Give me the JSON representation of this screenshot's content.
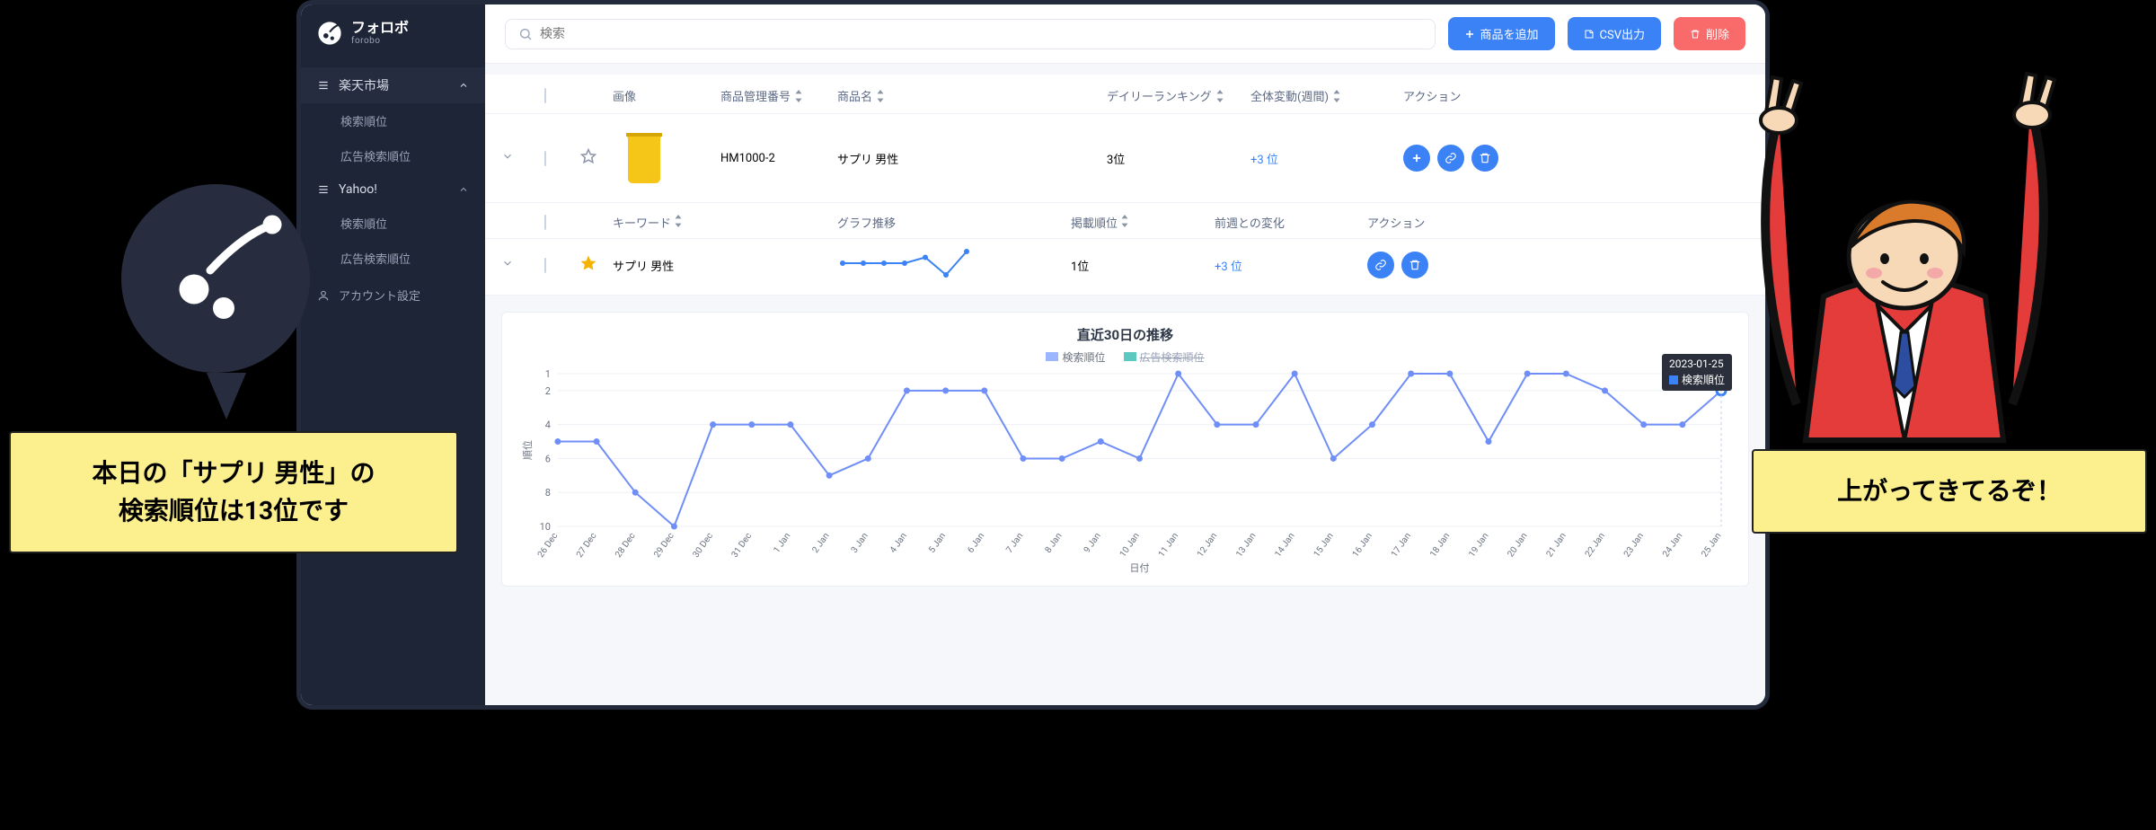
{
  "brand": {
    "ja": "フォロボ",
    "en": "forobo"
  },
  "sidebar": {
    "groups": [
      {
        "label": "楽天市場",
        "items": [
          "検索順位",
          "広告検索順位"
        ]
      },
      {
        "label": "Yahoo!",
        "items": [
          "検索順位",
          "広告検索順位"
        ]
      }
    ],
    "account": "アカウント設定"
  },
  "topbar": {
    "search_placeholder": "検索",
    "add_label": "商品を追加",
    "csv_label": "CSV出力",
    "delete_label": "削除"
  },
  "table": {
    "headers": {
      "image": "画像",
      "sku": "商品管理番号",
      "name": "商品名",
      "daily": "デイリーランキング",
      "weekly": "全体変動(週間)",
      "action": "アクション"
    },
    "row": {
      "sku": "HM1000-2",
      "name": "サプリ 男性",
      "daily": "3位",
      "weekly": "+3 位"
    }
  },
  "subtable": {
    "headers": {
      "keyword": "キーワード",
      "graph": "グラフ推移",
      "rank": "掲載順位",
      "weekchg": "前週との変化",
      "action": "アクション"
    },
    "row": {
      "keyword": "サプリ 男性",
      "rank": "1位",
      "weekchg": "+3 位"
    }
  },
  "callouts": {
    "left_l1": "本日の「サプリ 男性」の",
    "left_l2": "検索順位は13位です",
    "right": "上がってきてるぞ！"
  },
  "chart_data": {
    "type": "line",
    "title": "直近30日の推移",
    "xlabel": "日付",
    "ylabel": "順位",
    "ylim": [
      1,
      10
    ],
    "y_ticks": [
      1,
      2,
      4,
      6,
      8,
      10
    ],
    "legend": [
      "検索順位",
      "広告検索順位"
    ],
    "categories": [
      "26 Dec",
      "27 Dec",
      "28 Dec",
      "29 Dec",
      "30 Dec",
      "31 Dec",
      "1 Jan",
      "2 Jan",
      "3 Jan",
      "4 Jan",
      "5 Jan",
      "6 Jan",
      "7 Jan",
      "8 Jan",
      "9 Jan",
      "10 Jan",
      "11 Jan",
      "12 Jan",
      "13 Jan",
      "14 Jan",
      "15 Jan",
      "16 Jan",
      "17 Jan",
      "18 Jan",
      "19 Jan",
      "20 Jan",
      "21 Jan",
      "22 Jan",
      "23 Jan",
      "24 Jan",
      "25 Jan"
    ],
    "series": [
      {
        "name": "検索順位",
        "values": [
          5,
          5,
          8,
          10,
          4,
          4,
          4,
          7,
          6,
          2,
          2,
          2,
          6,
          6,
          5,
          6,
          1,
          4,
          4,
          1,
          6,
          4,
          1,
          1,
          5,
          1,
          1,
          2,
          4,
          4,
          2
        ]
      }
    ],
    "tooltip": {
      "date": "2023-01-25",
      "series": "検索順位"
    }
  },
  "sparkline": {
    "values": [
      4,
      4,
      4,
      4,
      3,
      6,
      2
    ]
  }
}
